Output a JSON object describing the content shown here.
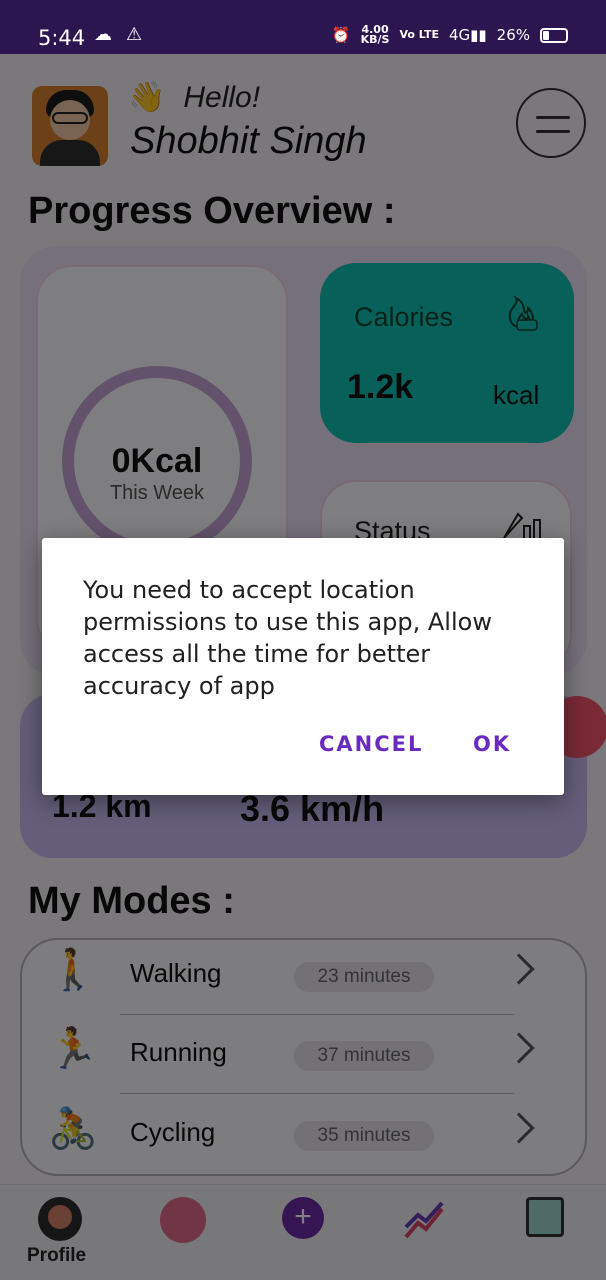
{
  "status_bar": {
    "time": "5:44",
    "speed_value": "4.00",
    "speed_unit": "KB/S",
    "network": "Vo LTE",
    "signal": "4G",
    "battery_percent": "26%"
  },
  "header": {
    "greeting": "Hello!",
    "wave_emoji": "👋",
    "user_name": "Shobhit Singh",
    "menu_icon": "hamburger-menu-icon"
  },
  "progress": {
    "title": "Progress Overview :",
    "weekly_value": "0Kcal",
    "weekly_label": "This Week",
    "calories_label": "Calories",
    "calories_value": "1.2k",
    "calories_unit": "kcal",
    "status_label": "Status"
  },
  "stats": {
    "distance": "1.2 km",
    "speed": "3.6 km/h"
  },
  "modes": {
    "title": "My Modes :",
    "items": [
      {
        "name": "Walking",
        "duration": "23 minutes",
        "emoji": "🚶"
      },
      {
        "name": "Running",
        "duration": "37 minutes",
        "emoji": "🏃"
      },
      {
        "name": "Cycling",
        "duration": "35 minutes",
        "emoji": "🚴"
      }
    ]
  },
  "bottom_nav": {
    "profile_label": "Profile",
    "add_symbol": "+"
  },
  "dialog": {
    "message": "You need to accept location permissions to use this app, Allow access all the time for better accuracy of app",
    "cancel_label": "CANCEL",
    "ok_label": "OK",
    "accent_color": "#6a2ac0"
  },
  "colors": {
    "status_bar": "#2c1650",
    "calories_card": "#0fc1b3",
    "stats_card": "#c9bdf5"
  }
}
